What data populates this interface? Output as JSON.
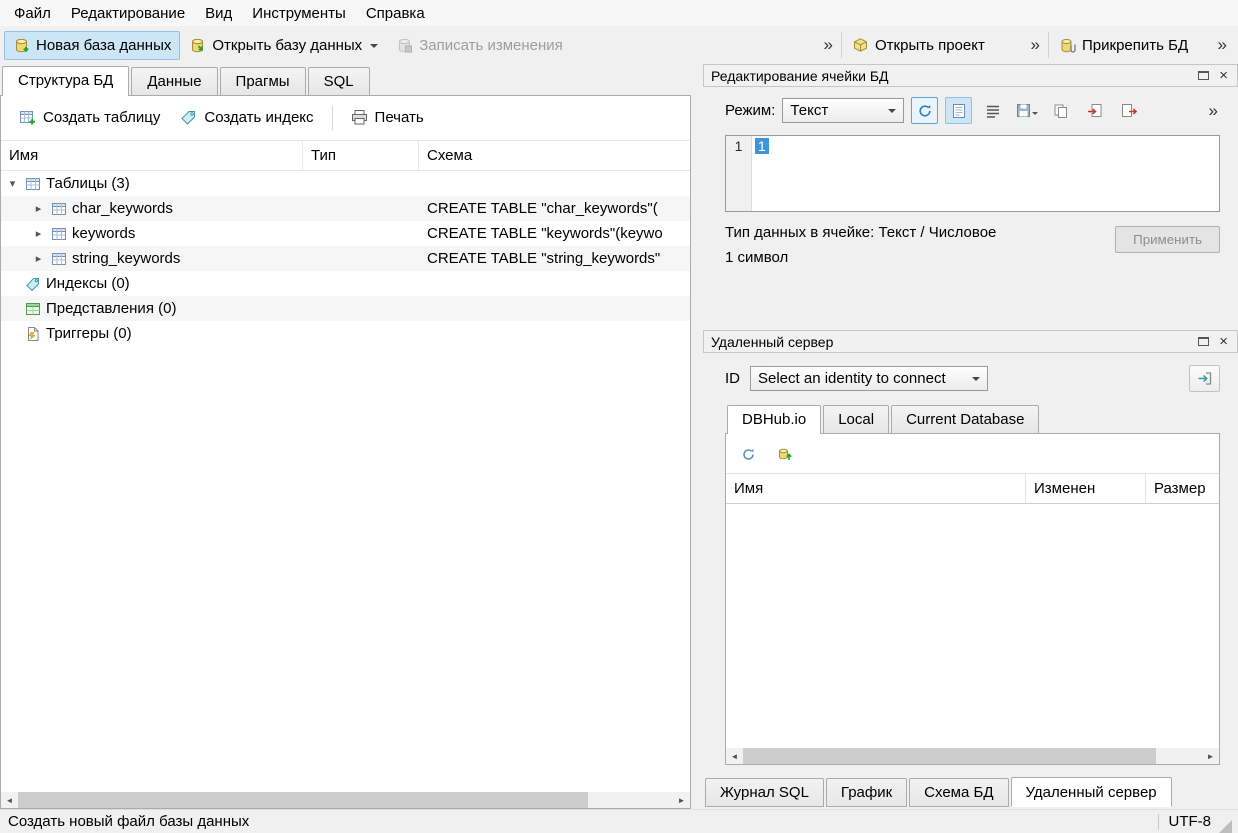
{
  "menu": {
    "items": [
      "Файл",
      "Редактирование",
      "Вид",
      "Инструменты",
      "Справка"
    ]
  },
  "toolbar": {
    "new_db": "Новая база данных",
    "open_db": "Открыть базу данных",
    "write_changes": "Записать изменения",
    "open_project": "Открыть проект",
    "attach_db": "Прикрепить БД",
    "overflow": "»"
  },
  "structure": {
    "tabs": [
      "Структура БД",
      "Данные",
      "Прагмы",
      "SQL"
    ],
    "actions": {
      "create_table": "Создать таблицу",
      "create_index": "Создать индекс",
      "print": "Печать"
    },
    "columns": [
      "Имя",
      "Тип",
      "Схема"
    ],
    "rows": [
      {
        "label": "Таблицы (3)",
        "schema": ""
      },
      {
        "label": "char_keywords",
        "schema": "CREATE TABLE \"char_keywords\"("
      },
      {
        "label": "keywords",
        "schema": "CREATE TABLE \"keywords\"(keywo"
      },
      {
        "label": "string_keywords",
        "schema": "CREATE TABLE \"string_keywords\""
      },
      {
        "label": "Индексы (0)",
        "schema": ""
      },
      {
        "label": "Представления (0)",
        "schema": ""
      },
      {
        "label": "Триггеры (0)",
        "schema": ""
      }
    ]
  },
  "edit_cell": {
    "title": "Редактирование ячейки БД",
    "mode_label": "Режим:",
    "mode_value": "Текст",
    "line_number": "1",
    "cell_text": "1",
    "type_info": "Тип данных в ячейке: Текст / Числовое",
    "size_info": "1 символ",
    "apply": "Применить"
  },
  "remote": {
    "title": "Удаленный сервер",
    "id_label": "ID",
    "identity_value": "Select an identity to connect",
    "tabs": [
      "DBHub.io",
      "Local",
      "Current Database"
    ],
    "columns": [
      "Имя",
      "Изменен",
      "Размер"
    ]
  },
  "bottom_tabs": [
    "Журнал SQL",
    "График",
    "Схема БД",
    "Удаленный сервер"
  ],
  "statusbar": {
    "message": "Создать новый файл базы данных",
    "encoding": "UTF-8"
  },
  "colors": {
    "toolbar_active_bg": "#cde6f7",
    "selection": "#3d95d8"
  }
}
